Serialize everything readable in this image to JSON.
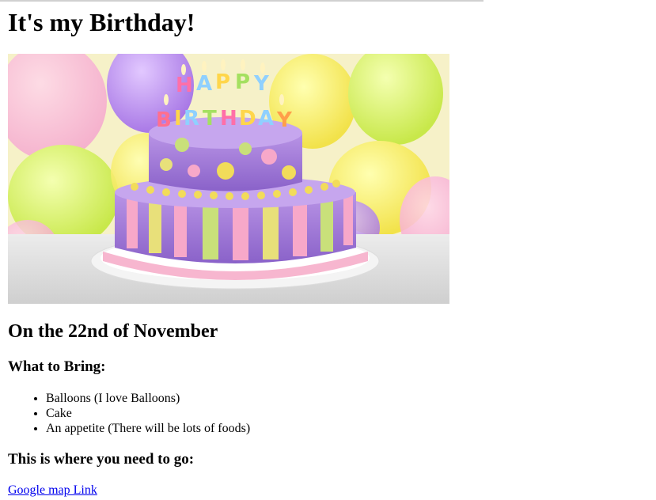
{
  "page": {
    "title": "It's my Birthday!",
    "date_heading": "On the 22nd of November",
    "bring_heading": "What to Bring:",
    "bring_items": [
      "Balloons (I love Balloons)",
      "Cake",
      "An appetite (There will be lots of foods)"
    ],
    "location_heading": "This is where you need to go:",
    "map_link_text": "Google map Link"
  },
  "hero_image": {
    "description_icon": "birthday-cake-image",
    "candle_letters_top": "HAPPY",
    "candle_letters_bottom": "BIRTHDAY"
  },
  "colors": {
    "link": "#0000ee"
  }
}
